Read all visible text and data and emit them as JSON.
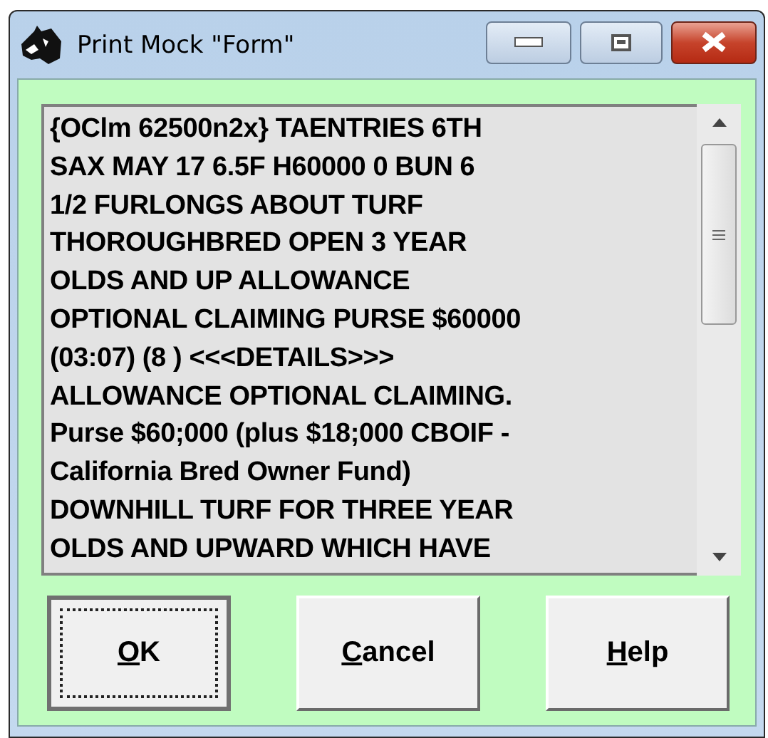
{
  "window": {
    "title": "Print Mock \"Form\""
  },
  "text_box": {
    "lines": [
      "{OClm 62500n2x} TAENTRIES 6TH",
      "SAX MAY 17 6.5F H60000 0 BUN 6",
      "1/2 FURLONGS ABOUT TURF",
      "THOROUGHBRED OPEN 3 YEAR",
      "OLDS AND UP ALLOWANCE",
      "OPTIONAL CLAIMING PURSE $60000",
      "(03:07) (8 ) <<<DETAILS>>>",
      "ALLOWANCE OPTIONAL CLAIMING.",
      "Purse $60;000 (plus $18;000 CBOIF -",
      "California Bred Owner Fund)",
      "DOWNHILL TURF FOR THREE YEAR",
      "OLDS AND UPWARD WHICH HAVE"
    ]
  },
  "buttons": [
    {
      "label": "OK",
      "focused": true
    },
    {
      "label": "Cancel",
      "focused": false
    },
    {
      "label": "Help",
      "focused": false
    }
  ]
}
